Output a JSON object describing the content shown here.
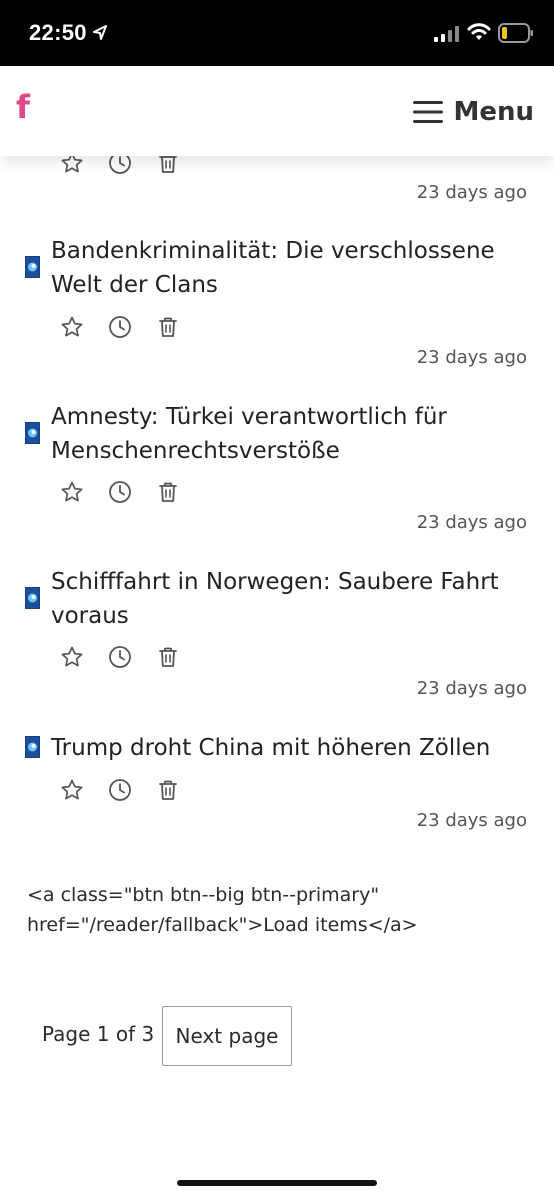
{
  "status_bar": {
    "time": "22:50"
  },
  "header": {
    "logo": "f",
    "menu_label": "Menu"
  },
  "articles": [
    {
      "title": "",
      "time_ago": "23 days ago"
    },
    {
      "title": "Bandenkriminalität: Die verschlossene Welt der Clans",
      "time_ago": "23 days ago"
    },
    {
      "title": "Amnesty: Türkei verantwortlich für Menschenrechtsverstöße",
      "time_ago": "23 days ago"
    },
    {
      "title": "Schifffahrt in Norwegen: Saubere Fahrt voraus",
      "time_ago": "23 days ago"
    },
    {
      "title": "Trump droht China mit höheren Zöllen",
      "time_ago": "23 days ago"
    }
  ],
  "raw_link_text": "<a class=\"btn btn--big btn--primary\" href=\"/reader/fallback\">Load items</a>",
  "pagination": {
    "page_info": "Page 1 of 3",
    "next_label": "Next page"
  },
  "icons": {
    "favorite": "star-icon",
    "read_later": "clock-icon",
    "delete": "trash-icon",
    "source": "source-favicon-icon"
  },
  "colors": {
    "brand": "#e0468a",
    "text": "#2b2b2b",
    "muted": "#555555"
  }
}
